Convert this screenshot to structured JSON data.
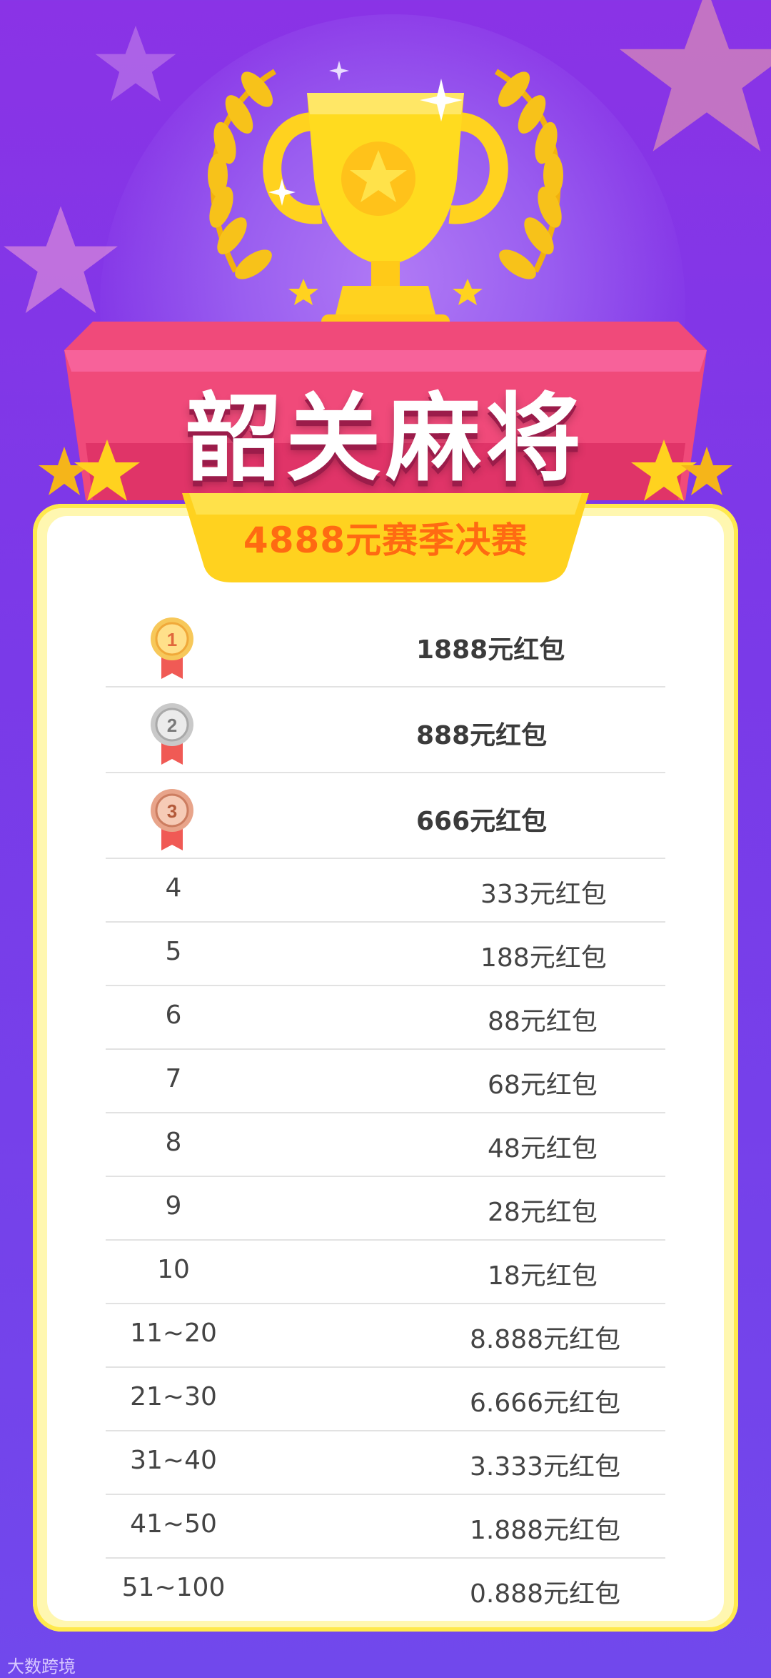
{
  "header": {
    "title": "韶关麻将",
    "subtitle": "4888元赛季决赛"
  },
  "prizes": [
    {
      "rank": "1",
      "medal": "gold-medal-icon",
      "prize": "1888元红包"
    },
    {
      "rank": "2",
      "medal": "silver-medal-icon",
      "prize": "888元红包"
    },
    {
      "rank": "3",
      "medal": "bronze-medal-icon",
      "prize": "666元红包"
    },
    {
      "rank": "4",
      "prize": "333元红包"
    },
    {
      "rank": "5",
      "prize": "188元红包"
    },
    {
      "rank": "6",
      "prize": "88元红包"
    },
    {
      "rank": "7",
      "prize": "68元红包"
    },
    {
      "rank": "8",
      "prize": "48元红包"
    },
    {
      "rank": "9",
      "prize": "28元红包"
    },
    {
      "rank": "10",
      "prize": "18元红包"
    },
    {
      "rank": "11~20",
      "prize": "8.888元红包"
    },
    {
      "rank": "21~30",
      "prize": "6.666元红包"
    },
    {
      "rank": "31~40",
      "prize": "3.333元红包"
    },
    {
      "rank": "41~50",
      "prize": "1.888元红包"
    },
    {
      "rank": "51~100",
      "prize": "0.888元红包"
    }
  ],
  "watermark": "大数跨境",
  "colors": {
    "background": "#7a3ae8",
    "ribbon": "#f04a7a",
    "gold": "#ffd400",
    "subtitle": "#ff6a12"
  }
}
